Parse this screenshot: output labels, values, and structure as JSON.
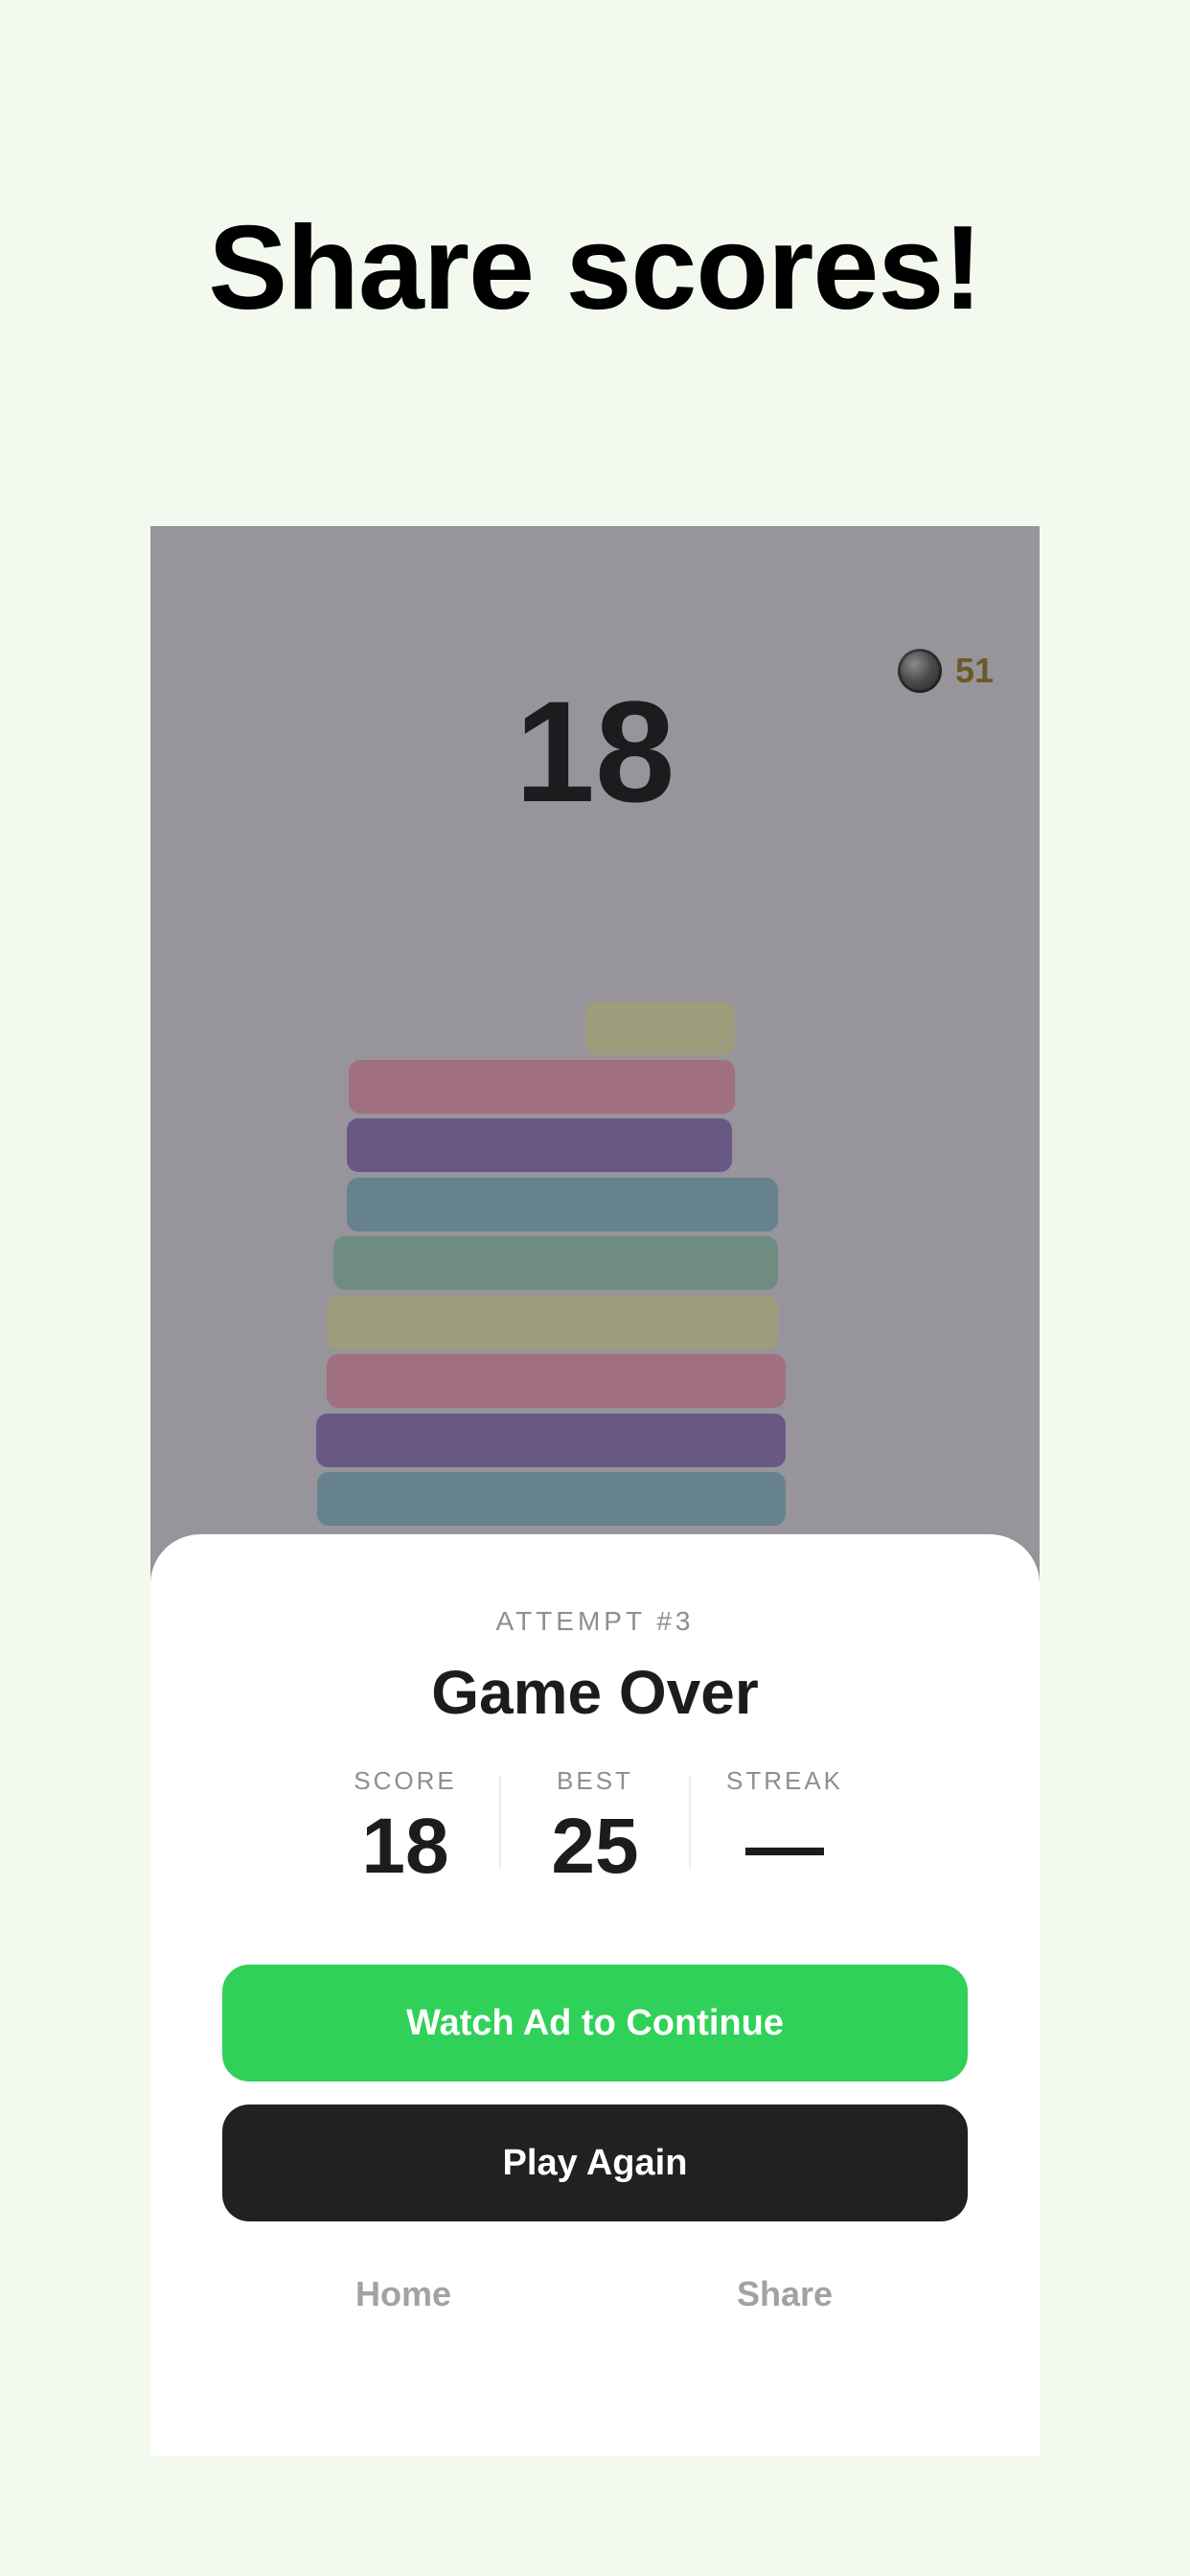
{
  "headline": "Share scores!",
  "game": {
    "current_score": "18",
    "coins": "51",
    "coin_icon": "coin-icon",
    "blocks": [
      {
        "color": "#9d9c7d"
      },
      {
        "color": "#a17080"
      },
      {
        "color": "#6a5884"
      },
      {
        "color": "#66828e"
      },
      {
        "color": "#6e8d80"
      },
      {
        "color": "#9d9c7d"
      },
      {
        "color": "#a17080"
      },
      {
        "color": "#6a5884"
      },
      {
        "color": "#66828e"
      }
    ]
  },
  "sheet": {
    "attempt": "ATTEMPT #3",
    "title": "Game Over",
    "stats": {
      "score_label": "SCORE",
      "score_value": "18",
      "best_label": "BEST",
      "best_value": "25",
      "streak_label": "STREAK",
      "streak_value": "—"
    },
    "watch_ad_label": "Watch Ad to Continue",
    "play_again_label": "Play Again",
    "home_label": "Home",
    "share_label": "Share"
  },
  "colors": {
    "accent_green": "#30d158",
    "dark_button": "#212121",
    "background": "#f3f9ef",
    "overlay": "#97949b"
  }
}
